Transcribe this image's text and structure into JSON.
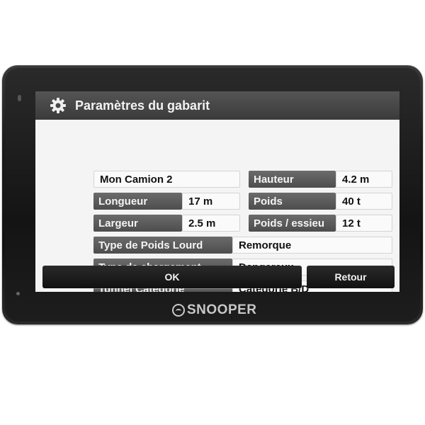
{
  "title": "Paramètres du gabarit",
  "profile": {
    "name": "Mon Camion 2"
  },
  "dimensions": {
    "hauteur_label": "Hauteur",
    "hauteur_value": "4.2 m",
    "longueur_label": "Longueur",
    "longueur_value": "17 m",
    "poids_label": "Poids",
    "poids_value": "40 t",
    "largeur_label": "Largeur",
    "largeur_value": "2.5 m",
    "essieu_label": "Poids / essieu",
    "essieu_value": "12 t"
  },
  "options": {
    "type_poids_label": "Type de Poids Lourd",
    "type_poids_value": "Remorque",
    "chargement_label": "Type de chargement",
    "chargement_value": "Dangereux",
    "tunnel_label": "Tunnel Catégorie",
    "tunnel_value": "Catégorie B/D"
  },
  "buttons": {
    "ok": "OK",
    "back": "Retour"
  },
  "brand": "SNOOPER",
  "icons": {
    "title_icon": "gear-icon"
  },
  "colors": {
    "titlebar": "#444444",
    "label_bg": "#5a5a5a",
    "button_bg": "#1a1a1a",
    "screen_bg": "#f4f4f4"
  }
}
